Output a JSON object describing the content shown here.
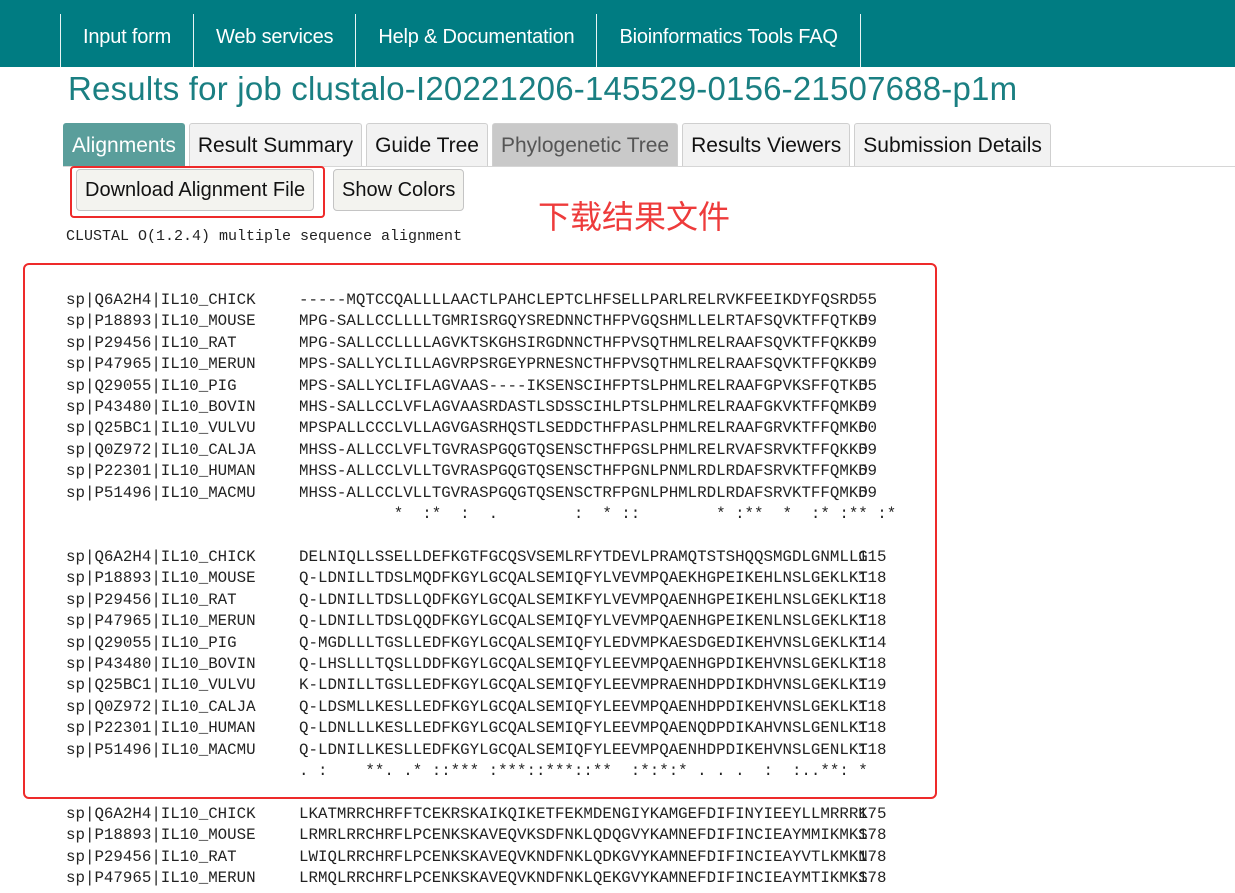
{
  "nav": [
    "Input form",
    "Web services",
    "Help & Documentation",
    "Bioinformatics Tools FAQ"
  ],
  "title": "Results for job clustalo-I20221206-145529-0156-21507688-p1m",
  "tabs": [
    "Alignments",
    "Result Summary",
    "Guide Tree",
    "Phylogenetic Tree",
    "Results Viewers",
    "Submission Details"
  ],
  "buttons": {
    "download": "Download Alignment File",
    "colors": "Show Colors"
  },
  "annotation": "下载结果文件",
  "clustal_header": "CLUSTAL O(1.2.4) multiple sequence alignment",
  "blocks": [
    {
      "rows": [
        {
          "id": "sp|Q6A2H4|IL10_CHICK",
          "seq": "-----MQTCCQALLLLAACTLPAHCLEPTCLHFSELLPARLRELRVKFEEIKDYFQSRD",
          "num": "55"
        },
        {
          "id": "sp|P18893|IL10_MOUSE",
          "seq": "MPG-SALLCCLLLLTGMRISRGQYSREDNNCTHFPVGQSHMLLELRTAFSQVKTFFQTKD",
          "num": "59"
        },
        {
          "id": "sp|P29456|IL10_RAT",
          "seq": "MPG-SALLCCLLLLAGVKTSKGHSIRGDNNCTHFPVSQTHMLRELRAAFSQVKTFFQKKD",
          "num": "59"
        },
        {
          "id": "sp|P47965|IL10_MERUN",
          "seq": "MPS-SALLYCLILLAGVRPSRGEYPRNESNCTHFPVSQTHMLRELRAAFSQVKTFFQKKD",
          "num": "59"
        },
        {
          "id": "sp|Q29055|IL10_PIG",
          "seq": "MPS-SALLYCLIFLAGVAAS----IKSENSCIHFPTSLPHMLRELRAAFGPVKSFFQTKD",
          "num": "55"
        },
        {
          "id": "sp|P43480|IL10_BOVIN",
          "seq": "MHS-SALLCCLVFLAGVAASRDASTLSDSSCIHLPTSLPHMLRELRAAFGKVKTFFQMKD",
          "num": "59"
        },
        {
          "id": "sp|Q25BC1|IL10_VULVU",
          "seq": "MPSPALLCCCLVLLAGVGASRHQSTLSEDDCTHFPASLPHMLRELRAAFGRVKTFFQMKD",
          "num": "60"
        },
        {
          "id": "sp|Q0Z972|IL10_CALJA",
          "seq": "MHSS-ALLCCLVFLTGVRASPGQGTQSENSCTHFPGSLPHMLRELRVAFSRVKTFFQKKD",
          "num": "59"
        },
        {
          "id": "sp|P22301|IL10_HUMAN",
          "seq": "MHSS-ALLCCLVLLTGVRASPGQGTQSENSCTHFPGNLPNMLRDLRDAFSRVKTFFQMKD",
          "num": "59"
        },
        {
          "id": "sp|P51496|IL10_MACMU",
          "seq": "MHSS-ALLCCLVLLTGVRASPGQGTQSENSCTRFPGNLPHMLRDLRDAFSRVKTFFQMKD",
          "num": "59"
        }
      ],
      "consensus": "          *  :*  :  .        :  * ::        * :**  *  :* :** :*"
    },
    {
      "rows": [
        {
          "id": "sp|Q6A2H4|IL10_CHICK",
          "seq": "DELNIQLLSSELLDEFKGTFGCQSVSEMLRFYTDEVLPRAMQTSTSHQQSMGDLGNMLLG",
          "num": "115"
        },
        {
          "id": "sp|P18893|IL10_MOUSE",
          "seq": "Q-LDNILLTDSLMQDFKGYLGCQALSEMIQFYLVEVMPQAEKHGPEIKEHLNSLGEKLKT",
          "num": "118"
        },
        {
          "id": "sp|P29456|IL10_RAT",
          "seq": "Q-LDNILLTDSLLQDFKGYLGCQALSEMIKFYLVEVMPQAENHGPEIKEHLNSLGEKLKT",
          "num": "118"
        },
        {
          "id": "sp|P47965|IL10_MERUN",
          "seq": "Q-LDNILLTDSLQQDFKGYLGCQALSEMIQFYLVEVMPQAENHGPEIKENLNSLGEKLKT",
          "num": "118"
        },
        {
          "id": "sp|Q29055|IL10_PIG",
          "seq": "Q-MGDLLLTGSLLEDFKGYLGCQALSEMIQFYLEDVMPKAESDGEDIKEHVNSLGEKLKT",
          "num": "114"
        },
        {
          "id": "sp|P43480|IL10_BOVIN",
          "seq": "Q-LHSLLLTQSLLDDFKGYLGCQALSEMIQFYLEEVMPQAENHGPDIKEHVNSLGEKLKT",
          "num": "118"
        },
        {
          "id": "sp|Q25BC1|IL10_VULVU",
          "seq": "K-LDNILLTGSLLEDFKGYLGCQALSEMIQFYLEEVMPRAENHDPDIKDHVNSLGEKLKT",
          "num": "119"
        },
        {
          "id": "sp|Q0Z972|IL10_CALJA",
          "seq": "Q-LDSMLLKESLLEDFKGYLGCQALSEMIQFYLEEVMPQAENHDPDIKEHVNSLGEKLKT",
          "num": "118"
        },
        {
          "id": "sp|P22301|IL10_HUMAN",
          "seq": "Q-LDNLLLKESLLEDFKGYLGCQALSEMIQFYLEEVMPQAENQDPDIKAHVNSLGENLKT",
          "num": "118"
        },
        {
          "id": "sp|P51496|IL10_MACMU",
          "seq": "Q-LDNILLKESLLEDFKGYLGCQALSEMIQFYLEEVMPQAENHDPDIKEHVNSLGENLKT",
          "num": "118"
        }
      ],
      "consensus": ". :    **. .* ::*** :***::***::**  :*:*:* . . .  :  :..**: *"
    },
    {
      "rows": [
        {
          "id": "sp|Q6A2H4|IL10_CHICK",
          "seq": "LKATMRRCHRFFTCEKRSKAIKQIKETFEKMDENGIYKAMGEFDIFINYIEEYLLMRRRK",
          "num": "175"
        },
        {
          "id": "sp|P18893|IL10_MOUSE",
          "seq": "LRMRLRRCHRFLPCENKSKAVEQVKSDFNKLQDQGVYKAMNEFDIFINCIEAYMMIKMKS",
          "num": "178"
        },
        {
          "id": "sp|P29456|IL10_RAT",
          "seq": "LWIQLRRCHRFLPCENKSKAVEQVKNDFNKLQDKGVYKAMNEFDIFINCIEAYVTLKMKN",
          "num": "178"
        },
        {
          "id": "sp|P47965|IL10_MERUN",
          "seq": "LRMQLRRCHRFLPCENKSKAVEQVKNDFNKLQEKGVYKAMNEFDIFINCIEAYMTIKMKS",
          "num": "178"
        }
      ]
    }
  ]
}
